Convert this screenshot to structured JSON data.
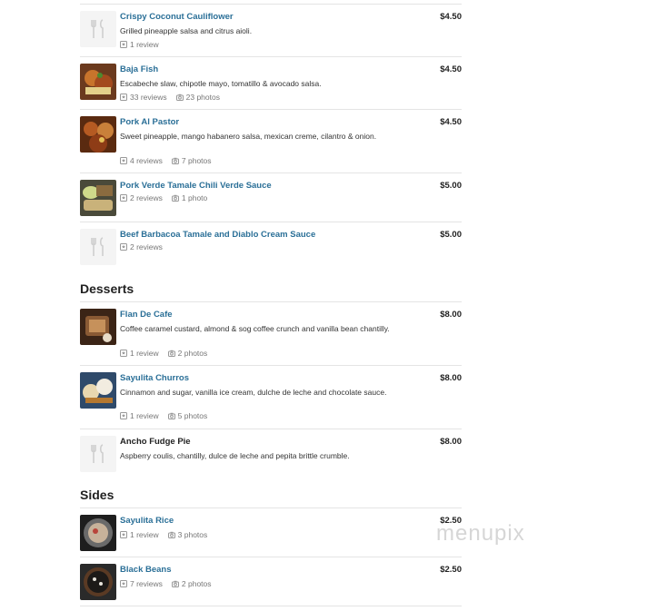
{
  "sections": [
    {
      "title": "",
      "items": [
        {
          "name": "Crispy Coconut Cauliflower",
          "price": "$4.50",
          "desc": "Grilled pineapple salsa and citrus aioli.",
          "reviews": "1 review",
          "photos": "",
          "thumb": "placeholder"
        },
        {
          "name": "Baja Fish",
          "price": "$4.50",
          "desc": "Escabeche slaw, chipotle mayo, tomatillo & avocado salsa.",
          "reviews": "33 reviews",
          "photos": "23 photos",
          "thumb": "photo"
        },
        {
          "name": "Pork Al Pastor",
          "price": "$4.50",
          "desc": "Sweet pineapple, mango habanero salsa, mexican creme, cilantro & onion.",
          "reviews": "4 reviews",
          "photos": "7 photos",
          "thumb": "photo"
        },
        {
          "name": "Pork Verde Tamale Chili Verde Sauce",
          "price": "$5.00",
          "desc": "",
          "reviews": "2 reviews",
          "photos": "1 photo",
          "thumb": "photo"
        },
        {
          "name": "Beef Barbacoa Tamale and Diablo Cream Sauce",
          "price": "$5.00",
          "desc": "",
          "reviews": "2 reviews",
          "photos": "",
          "thumb": "placeholder"
        }
      ]
    },
    {
      "title": "Desserts",
      "items": [
        {
          "name": "Flan De Cafe",
          "price": "$8.00",
          "desc": "Coffee caramel custard, almond & sog coffee crunch and vanilla bean chantilly.",
          "reviews": "1 review",
          "photos": "2 photos",
          "thumb": "photo"
        },
        {
          "name": "Sayulita Churros",
          "price": "$8.00",
          "desc": "Cinnamon and sugar, vanilla ice cream, dulche de leche and chocolate sauce.",
          "reviews": "1 review",
          "photos": "5 photos",
          "thumb": "photo"
        },
        {
          "name": "Ancho Fudge Pie",
          "price": "$8.00",
          "desc": "Aspberry coulis, chantilly, dulce de leche and pepita brittle crumble.",
          "reviews": "",
          "photos": "",
          "thumb": "placeholder",
          "plain": true
        }
      ]
    },
    {
      "title": "Sides",
      "items": [
        {
          "name": "Sayulita Rice",
          "price": "$2.50",
          "desc": "",
          "reviews": "1 review",
          "photos": "3 photos",
          "thumb": "photo"
        },
        {
          "name": "Black Beans",
          "price": "$2.50",
          "desc": "",
          "reviews": "7 reviews",
          "photos": "2 photos",
          "thumb": "photo"
        }
      ]
    }
  ],
  "watermark": "menupix",
  "colors": {
    "link": "#2a6f97",
    "divider": "#e4e4e4",
    "meta": "#777777"
  }
}
